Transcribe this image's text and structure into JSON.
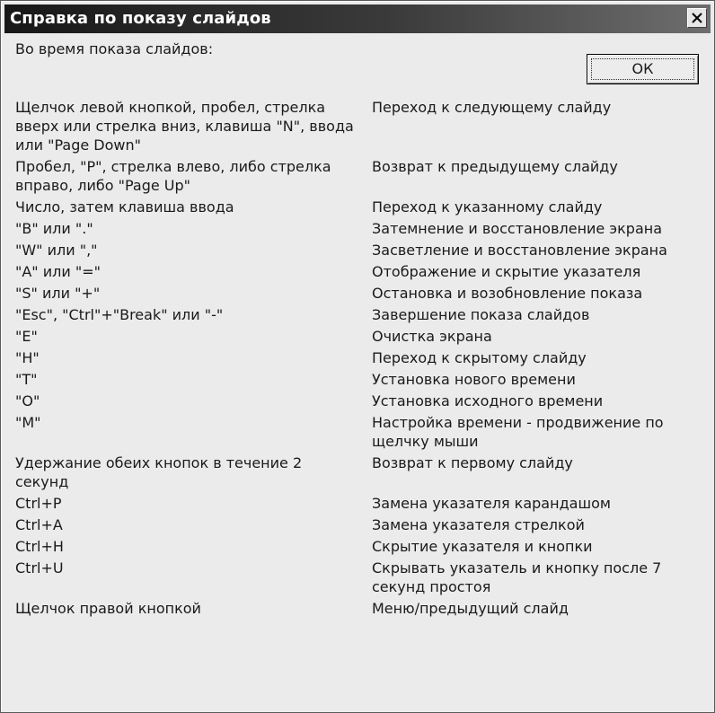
{
  "dialog": {
    "title": "Справка по показу слайдов",
    "intro": "Во время показа слайдов:",
    "ok_label": "ОК"
  },
  "shortcuts": [
    {
      "key": "Щелчок левой кнопкой, пробел, стрелка вверх или стрелка вниз, клавиша \"N\", ввода или \"Page Down\"",
      "action": "Переход к следующему слайду"
    },
    {
      "key": "Пробел, \"P\", стрелка влево, либо стрелка вправо, либо \"Page Up\"",
      "action": "Возврат к предыдущему слайду"
    },
    {
      "key": "Число, затем клавиша ввода",
      "action": "Переход к указанному слайду"
    },
    {
      "key": "\"B\" или \".\"",
      "action": "Затемнение и восстановление экрана"
    },
    {
      "key": "\"W\" или \",\"",
      "action": "Засветление и восстановление экрана"
    },
    {
      "key": "\"A\" или \"=\"",
      "action": "Отображение и скрытие указателя"
    },
    {
      "key": "\"S\" или \"+\"",
      "action": "Остановка и возобновление показа"
    },
    {
      "key": "\"Esc\", \"Ctrl\"+\"Break\" или \"-\"",
      "action": "Завершение показа слайдов"
    },
    {
      "key": "\"E\"",
      "action": "Очистка экрана"
    },
    {
      "key": "\"H\"",
      "action": "Переход к скрытому слайду"
    },
    {
      "key": "\"T\"",
      "action": "Установка нового времени"
    },
    {
      "key": "\"O\"",
      "action": "Установка исходного времени"
    },
    {
      "key": "\"M\"",
      "action": "Настройка времени - продвижение по щелчку мыши"
    },
    {
      "key": "Удержание обеих кнопок в течение 2 секунд",
      "action": "Возврат к первому слайду"
    },
    {
      "key": "Ctrl+P",
      "action": "Замена указателя карандашом"
    },
    {
      "key": "Ctrl+A",
      "action": "Замена указателя стрелкой"
    },
    {
      "key": "Ctrl+H",
      "action": "Скрытие указателя и кнопки"
    },
    {
      "key": "Ctrl+U",
      "action": "Скрывать указатель и кнопку после 7 секунд простоя"
    },
    {
      "key": "Щелчок правой кнопкой",
      "action": "Меню/предыдущий слайд"
    }
  ]
}
